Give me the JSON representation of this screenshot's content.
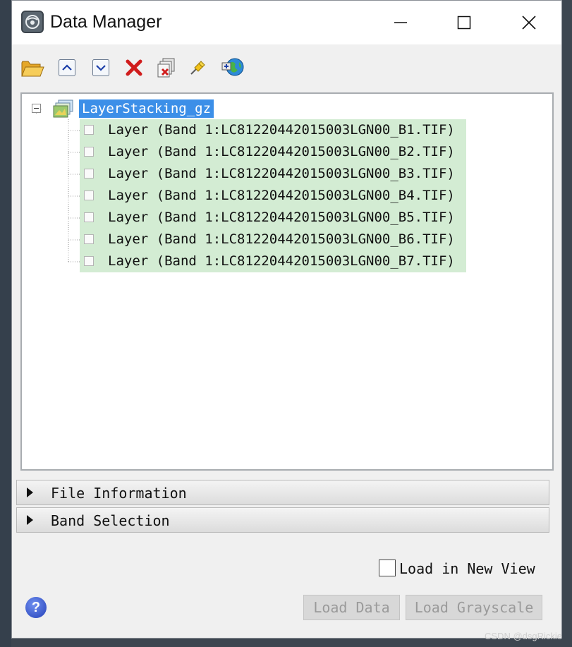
{
  "window": {
    "title": "Data Manager",
    "controls": {
      "minimize": "minimize",
      "maximize": "maximize",
      "close": "close"
    }
  },
  "toolbar": {
    "icons": [
      "open-folder-icon",
      "move-up-icon",
      "move-down-icon",
      "remove-icon",
      "close-all-icon",
      "pin-icon",
      "new-view-globe-icon"
    ]
  },
  "tree": {
    "root": {
      "label": "LayerStacking_gz",
      "expanded": true,
      "selected": true
    },
    "layers": [
      {
        "label": "Layer (Band 1:LC81220442015003LGN00_B1.TIF)",
        "checked": false
      },
      {
        "label": "Layer (Band 1:LC81220442015003LGN00_B2.TIF)",
        "checked": false
      },
      {
        "label": "Layer (Band 1:LC81220442015003LGN00_B3.TIF)",
        "checked": false
      },
      {
        "label": "Layer (Band 1:LC81220442015003LGN00_B4.TIF)",
        "checked": false
      },
      {
        "label": "Layer (Band 1:LC81220442015003LGN00_B5.TIF)",
        "checked": false
      },
      {
        "label": "Layer (Band 1:LC81220442015003LGN00_B6.TIF)",
        "checked": false
      },
      {
        "label": "Layer (Band 1:LC81220442015003LGN00_B7.TIF)",
        "checked": false
      }
    ],
    "row_highlight_color": "#d3ecd3",
    "selection_color": "#3c8fe8"
  },
  "sections": {
    "file_information": {
      "label": "File Information",
      "expanded": false
    },
    "band_selection": {
      "label": "Band Selection",
      "expanded": false
    }
  },
  "options": {
    "load_in_new_view": {
      "label": "Load in New View",
      "checked": false
    }
  },
  "buttons": {
    "load_data": "Load Data",
    "load_grayscale": "Load Grayscale"
  },
  "watermark": "CSDN @dsgRickie"
}
